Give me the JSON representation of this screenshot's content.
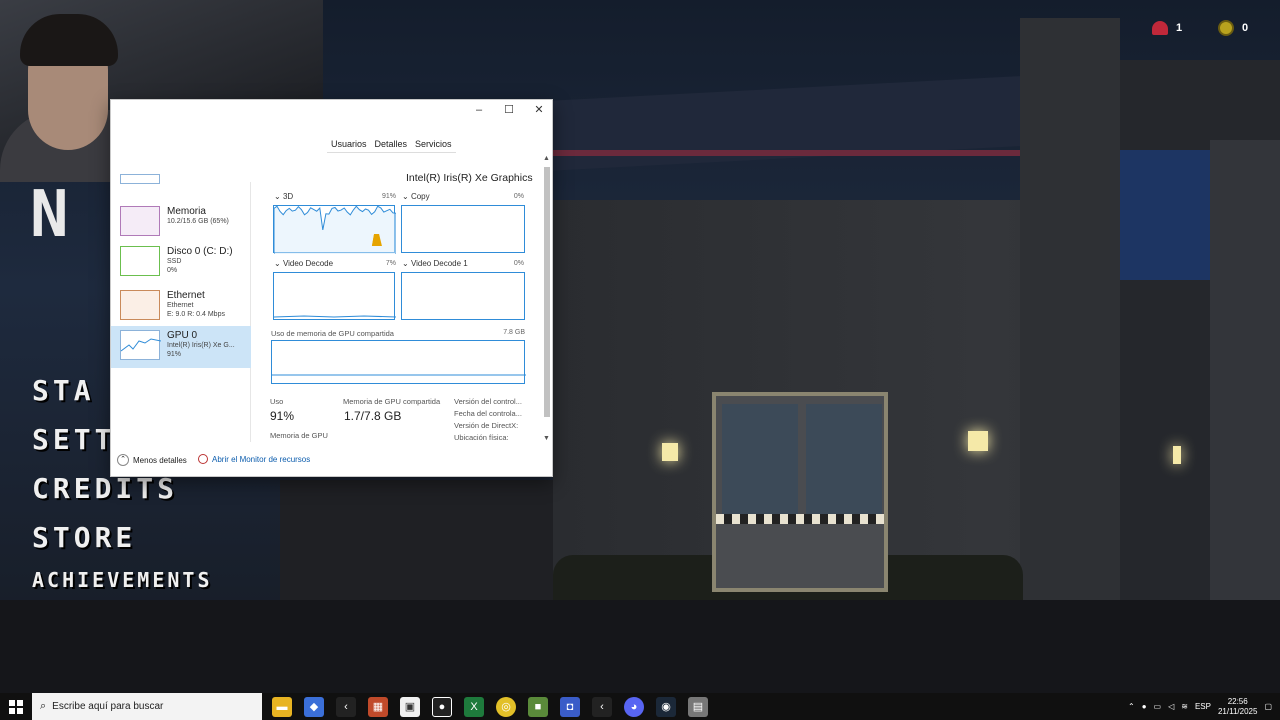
{
  "game": {
    "title_partial": "N",
    "menu": [
      "STA",
      "SETT",
      "CREDITS",
      "STORE",
      "ACHIEVEMENTS"
    ],
    "hud": {
      "lives": "1",
      "coins": "0"
    }
  },
  "task_manager": {
    "tabs": [
      "Usuarios",
      "Detalles",
      "Servicios"
    ],
    "resources": [
      {
        "name": "Memoria",
        "detail": "10.2/15.6 GB (65%)",
        "detail2": ""
      },
      {
        "name": "Disco 0 (C: D:)",
        "detail": "SSD",
        "detail2": "0%"
      },
      {
        "name": "Ethernet",
        "detail": "Ethernet",
        "detail2": "E: 9.0  R: 0.4 Mbps"
      },
      {
        "name": "GPU 0",
        "detail": "Intel(R) Iris(R) Xe G...",
        "detail2": "91%"
      }
    ],
    "gpu_name": "Intel(R) Iris(R) Xe Graphics",
    "engines": [
      {
        "label": "3D",
        "pct": "91%",
        "value": 91
      },
      {
        "label": "Copy",
        "pct": "0%",
        "value": 0
      },
      {
        "label": "Video Decode",
        "pct": "7%",
        "value": 7
      },
      {
        "label": "Video Decode 1",
        "pct": "0%",
        "value": 0
      }
    ],
    "shared_mem_label": "Uso de memoria de GPU compartida",
    "shared_mem_max": "7.8 GB",
    "stats": {
      "uso_label": "Uso",
      "uso_value": "91%",
      "shared_label": "Memoria de GPU compartida",
      "shared_value": "1.7/7.8 GB",
      "gpu_mem_label": "Memoria de GPU",
      "driver_labels": [
        "Versión del control...",
        "Fecha del controla...",
        "Versión de DirectX:",
        "Ubicación física:"
      ]
    },
    "footer": {
      "less_details": "Menos detalles",
      "open_monitor": "Abrir el Monitor de recursos"
    }
  },
  "taskbar": {
    "search_placeholder": "Escribe aquí para buscar",
    "language": "ESP",
    "time": "22:56",
    "date": "21/11/2025"
  },
  "colors": {
    "accent": "#2f8cd8",
    "selected": "#cce4f7",
    "taskbar": "#101010"
  }
}
